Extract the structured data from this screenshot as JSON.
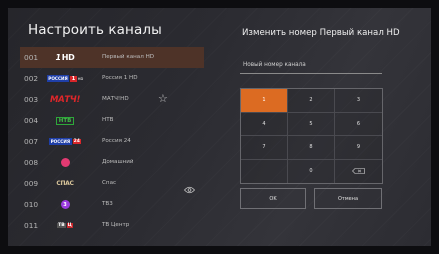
{
  "left_panel": {
    "title": "Настроить каналы",
    "channels": [
      {
        "number": "001",
        "name": "Первый канал HD",
        "logo": "1HD",
        "selected": true
      },
      {
        "number": "002",
        "name": "Россия 1 HD",
        "logo": "Россия 1 HD"
      },
      {
        "number": "003",
        "name": "МАТЧ!HD",
        "logo": "МАТЧ!",
        "favorite": true
      },
      {
        "number": "004",
        "name": "НТВ",
        "logo": "НТВ"
      },
      {
        "number": "007",
        "name": "Россия 24",
        "logo": "Россия 24"
      },
      {
        "number": "008",
        "name": "Домашний",
        "logo": "Домашний"
      },
      {
        "number": "009",
        "name": "Спас",
        "logo": "Спас",
        "hidden_icon": true
      },
      {
        "number": "010",
        "name": "ТВ3",
        "logo": "ТВ3"
      },
      {
        "number": "011",
        "name": "ТВ Центр",
        "logo": "ТВЦ"
      }
    ],
    "logo_texts": {
      "one_hd_one": "1",
      "one_hd_hd": "HD",
      "russia": "РОССИЯ",
      "russia1_num": "1",
      "russia1_hd": "HD",
      "match": "МАТЧ!",
      "ntv": "НТВ",
      "russia24_num": "24",
      "spas": "СПАС",
      "tv3": "3",
      "tvc_t": "ТВ",
      "tvc_c": "Ц"
    }
  },
  "right_panel": {
    "title": "Изменить номер Первый канал HD",
    "input_placeholder": "Новый номер канала",
    "keypad": [
      "1",
      "2",
      "3",
      "4",
      "5",
      "6",
      "7",
      "8",
      "9",
      "",
      "0",
      "backspace"
    ],
    "active_key": "1",
    "ok_label": "OK",
    "cancel_label": "Отмена"
  },
  "colors": {
    "accent": "#dc6b22",
    "selected_row": "#4e3328"
  }
}
